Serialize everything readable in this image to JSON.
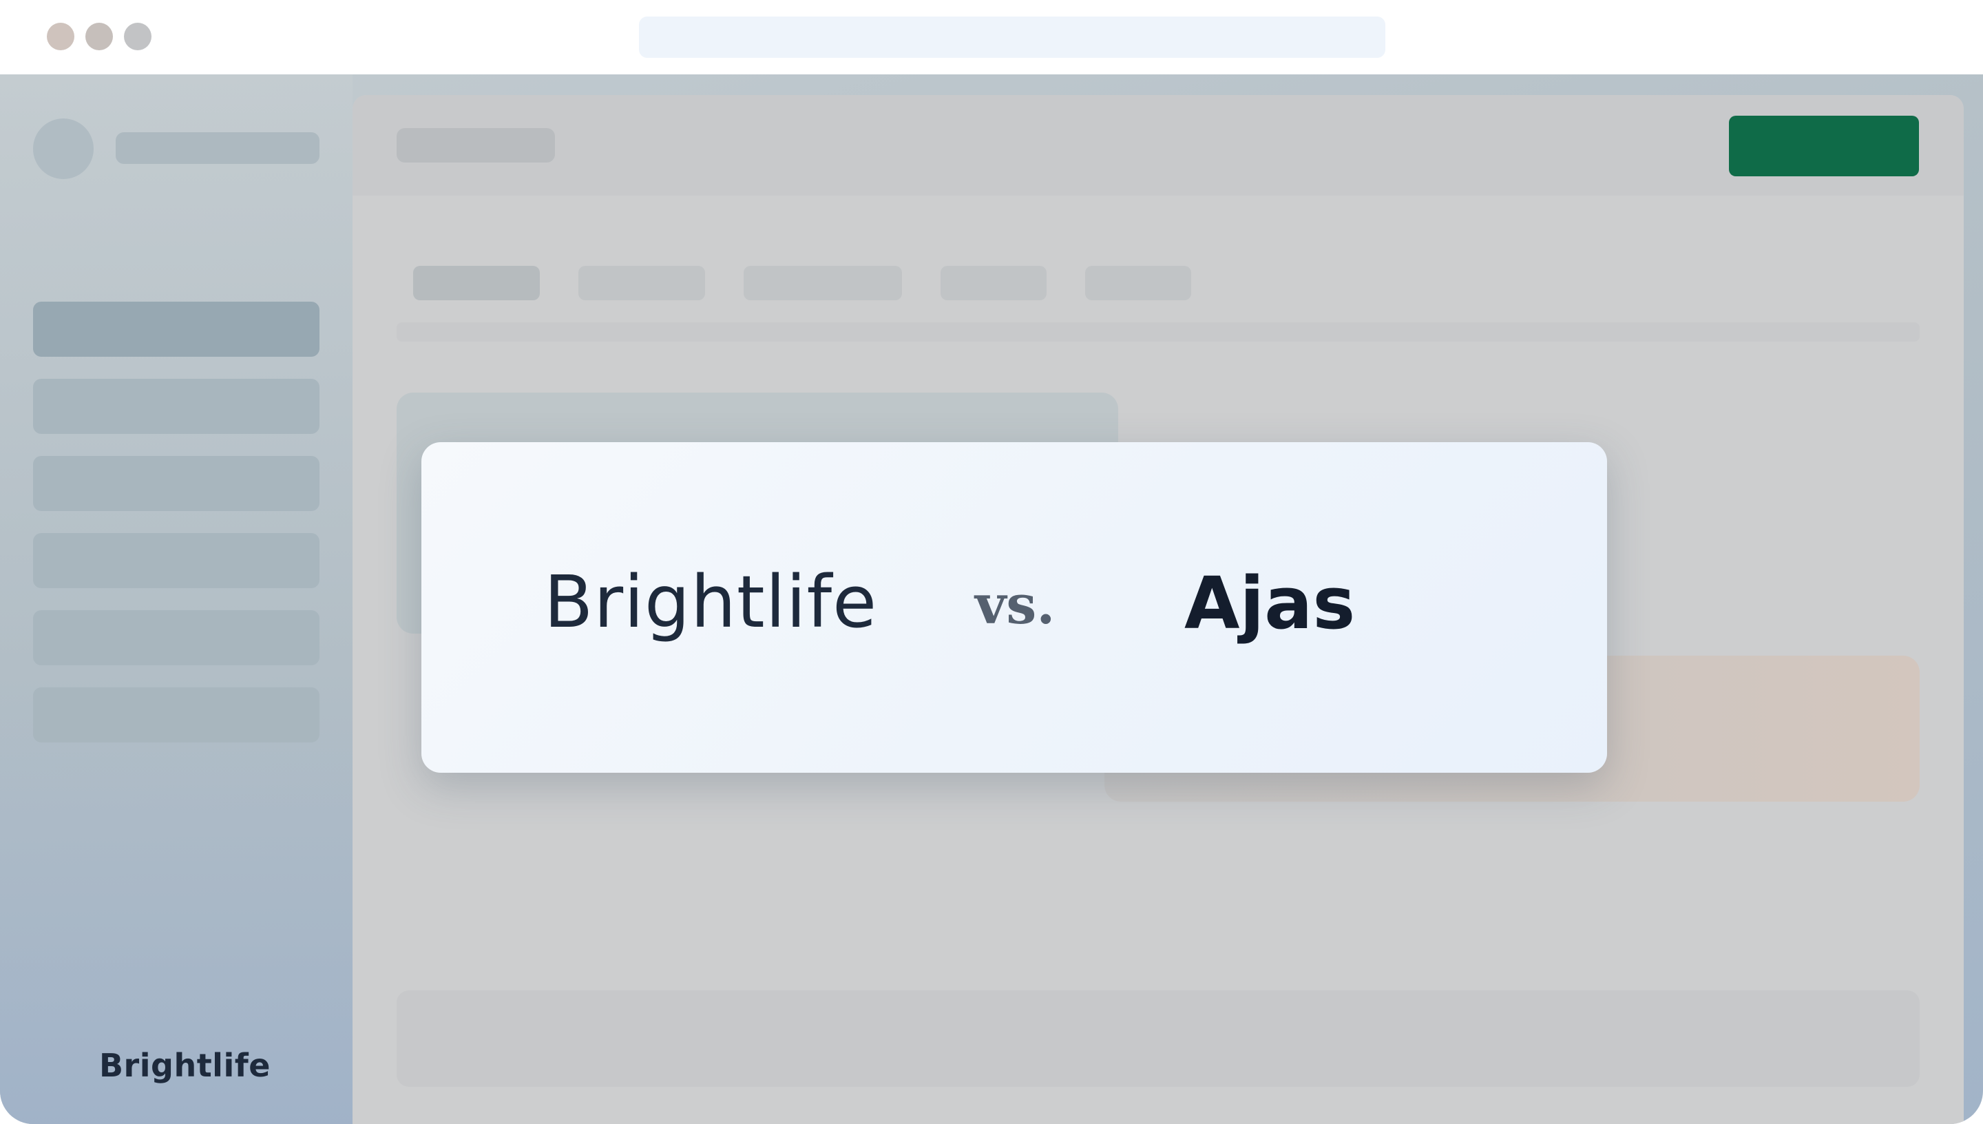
{
  "window": {
    "traffic_lights": [
      "#cfc3bd",
      "#c6bfbb",
      "#c2c3c5"
    ]
  },
  "sidebar": {
    "logo": "Brightlife"
  },
  "comparison": {
    "brand_a": "Brightlife",
    "vs": "vs.",
    "brand_b": "Ajas"
  },
  "colors": {
    "primary_button": "#0f6b48",
    "brand_text": "#1e2a3c"
  }
}
